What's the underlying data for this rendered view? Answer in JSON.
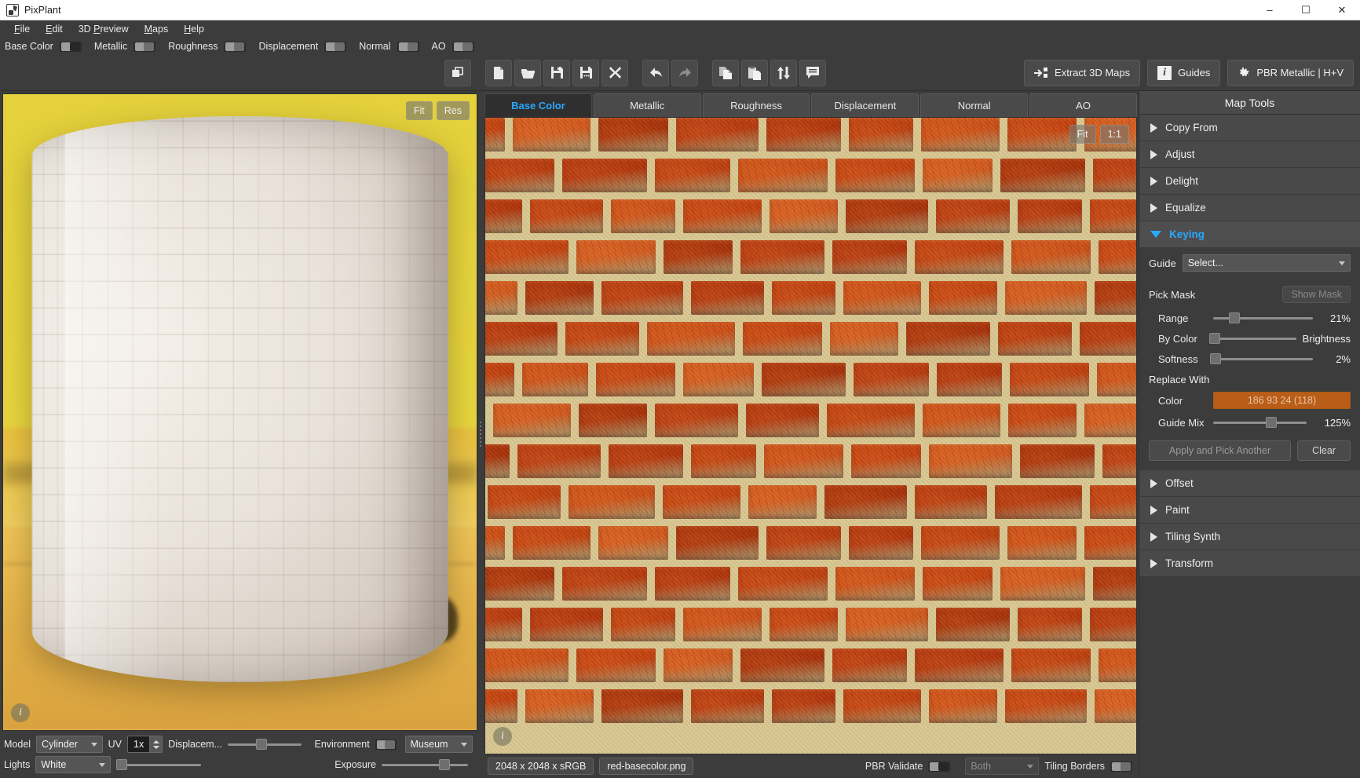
{
  "window": {
    "title": "PixPlant",
    "app_icon": "pixplant-logo-icon",
    "minimize": "–",
    "maximize": "☐",
    "close": "✕"
  },
  "menu": {
    "items": [
      {
        "label": "File",
        "mnemonic": "F"
      },
      {
        "label": "Edit",
        "mnemonic": "E"
      },
      {
        "label": "3D Preview",
        "mnemonic": "P"
      },
      {
        "label": "Maps",
        "mnemonic": "M"
      },
      {
        "label": "Help",
        "mnemonic": "H"
      }
    ]
  },
  "map_visibility": {
    "items": [
      {
        "label": "Base Color",
        "state": "off"
      },
      {
        "label": "Metallic",
        "state": "on"
      },
      {
        "label": "Roughness",
        "state": "on"
      },
      {
        "label": "Displacement",
        "state": "on"
      },
      {
        "label": "Normal",
        "state": "on"
      },
      {
        "label": "AO",
        "state": "on"
      }
    ]
  },
  "toolbar": {
    "buttons": [
      {
        "name": "windows-icon",
        "tip": "Windows"
      },
      {
        "name": "new-icon",
        "tip": "New"
      },
      {
        "name": "open-icon",
        "tip": "Open"
      },
      {
        "name": "save-icon",
        "tip": "Save"
      },
      {
        "name": "save-as-icon",
        "tip": "Save As"
      },
      {
        "name": "close-icon",
        "tip": "Close"
      },
      {
        "name": "undo-icon",
        "tip": "Undo"
      },
      {
        "name": "redo-icon",
        "tip": "Redo"
      },
      {
        "name": "copy-icon",
        "tip": "Copy"
      },
      {
        "name": "paste-icon",
        "tip": "Paste"
      },
      {
        "name": "swap-icon",
        "tip": "Swap"
      },
      {
        "name": "notes-icon",
        "tip": "Notes"
      }
    ],
    "extract_label": "Extract 3D Maps",
    "guides_label": "Guides",
    "pbr_label": "PBR Metallic | H+V"
  },
  "preview3d": {
    "fit_label": "Fit",
    "res_label": "Res",
    "info_icon": "info-icon",
    "controls": {
      "model_label": "Model",
      "model_value": "Cylinder",
      "uv_label": "UV",
      "uv_value": "1x",
      "displacement_label": "Displacem...",
      "environment_label": "Environment",
      "environment_toggle": "on",
      "environment_value": "Museum",
      "lights_label": "Lights",
      "lights_value": "White",
      "exposure_label": "Exposure"
    }
  },
  "texture_panel": {
    "tabs": [
      {
        "label": "Base Color",
        "active": true
      },
      {
        "label": "Metallic",
        "active": false
      },
      {
        "label": "Roughness",
        "active": false
      },
      {
        "label": "Displacement",
        "active": false
      },
      {
        "label": "Normal",
        "active": false
      },
      {
        "label": "AO",
        "active": false
      }
    ],
    "fit_label": "Fit",
    "oneone_label": "1:1",
    "info_icon": "info-icon",
    "status": {
      "dimensions": "2048 x 2048 x sRGB",
      "filename": "red-basecolor.png",
      "pbr_validate_label": "PBR Validate",
      "pbr_validate_state": "off",
      "pbr_mode_value": "Both",
      "tiling_borders_label": "Tiling Borders",
      "tiling_borders_state": "on"
    }
  },
  "map_tools": {
    "title": "Map Tools",
    "sections": [
      {
        "label": "Copy From",
        "open": false
      },
      {
        "label": "Adjust",
        "open": false
      },
      {
        "label": "Delight",
        "open": false
      },
      {
        "label": "Equalize",
        "open": false
      },
      {
        "label": "Keying",
        "open": true
      },
      {
        "label": "Offset",
        "open": false
      },
      {
        "label": "Paint",
        "open": false
      },
      {
        "label": "Tiling Synth",
        "open": false
      },
      {
        "label": "Transform",
        "open": false
      }
    ],
    "keying": {
      "guide_label": "Guide",
      "guide_value": "Select...",
      "pick_mask_label": "Pick Mask",
      "show_mask_label": "Show Mask",
      "range_label": "Range",
      "range_value": "21%",
      "range_pct": 21,
      "by_color_label": "By Color",
      "by_color_value": "Brightness",
      "by_color_pct": 2,
      "softness_label": "Softness",
      "softness_value": "2%",
      "softness_pct": 2,
      "replace_with_label": "Replace With",
      "color_label": "Color",
      "color_value": "186 93 24 (118)",
      "color_hex": "#ba5d18",
      "guide_mix_label": "Guide Mix",
      "guide_mix_value": "125%",
      "guide_mix_pct": 62,
      "apply_label": "Apply and Pick Another",
      "clear_label": "Clear"
    }
  },
  "colors": {
    "accent": "#29a8ff",
    "panel": "#3c3c3c",
    "control": "#4a4a4a",
    "swatch": "#ba5d18"
  }
}
